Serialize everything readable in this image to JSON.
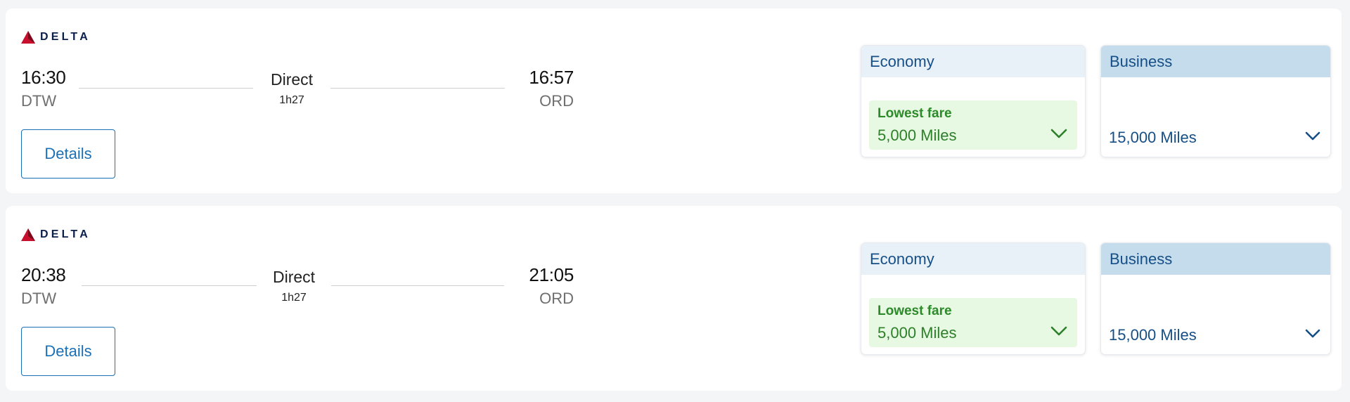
{
  "airline": {
    "name": "DELTA"
  },
  "colors": {
    "brand_red": "#c8102e",
    "brand_navy": "#0b1f4d",
    "link_blue": "#1a6fb5",
    "economy_header_bg": "#e9f1f8",
    "business_header_bg": "#c4dcec",
    "lowest_fare_bg": "#e7f9e2",
    "lowest_fare_text": "#2d8a2a"
  },
  "flights": [
    {
      "departure_time": "16:30",
      "departure_airport": "DTW",
      "stops": "Direct",
      "duration": "1h27",
      "arrival_time": "16:57",
      "arrival_airport": "ORD",
      "details_label": "Details",
      "economy": {
        "label": "Economy",
        "badge": "Lowest fare",
        "price": "5,000 Miles",
        "icon": "chevron-down-icon"
      },
      "business": {
        "label": "Business",
        "price": "15,000 Miles",
        "icon": "chevron-down-icon"
      }
    },
    {
      "departure_time": "20:38",
      "departure_airport": "DTW",
      "stops": "Direct",
      "duration": "1h27",
      "arrival_time": "21:05",
      "arrival_airport": "ORD",
      "details_label": "Details",
      "economy": {
        "label": "Economy",
        "badge": "Lowest fare",
        "price": "5,000 Miles",
        "icon": "chevron-down-icon"
      },
      "business": {
        "label": "Business",
        "price": "15,000 Miles",
        "icon": "chevron-down-icon"
      }
    }
  ]
}
